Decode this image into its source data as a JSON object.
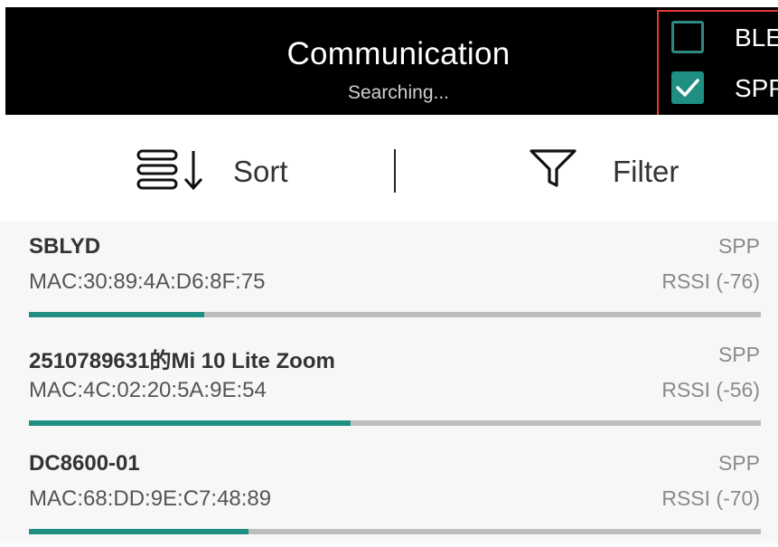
{
  "header": {
    "title": "Communication",
    "subtitle": "Searching...",
    "background": "#000000"
  },
  "modes": [
    {
      "label": "BLE",
      "checked": false
    },
    {
      "label": "SPP",
      "checked": true
    }
  ],
  "toolbar": {
    "sort_label": "Sort",
    "sort_icon": "sort-icon",
    "filter_label": "Filter",
    "filter_icon": "filter-icon"
  },
  "devices": [
    {
      "name": "SBLYD",
      "mac": "MAC:30:89:4A:D6:8F:75",
      "type": "SPP",
      "rssi": "RSSI (-76)",
      "signal_fraction": 0.24
    },
    {
      "name": "2510789631的Mi 10 Lite Zoom",
      "mac": "MAC:4C:02:20:5A:9E:54",
      "type": "SPP",
      "rssi": "RSSI (-56)",
      "signal_fraction": 0.44
    },
    {
      "name": "DC8600-01",
      "mac": "MAC:68:DD:9E:C7:48:89",
      "type": "SPP",
      "rssi": "RSSI (-70)",
      "signal_fraction": 0.3
    }
  ],
  "colors": {
    "accent": "#1f8f82",
    "highlight_border": "#e53935",
    "bar_track": "#bdbdbd"
  }
}
